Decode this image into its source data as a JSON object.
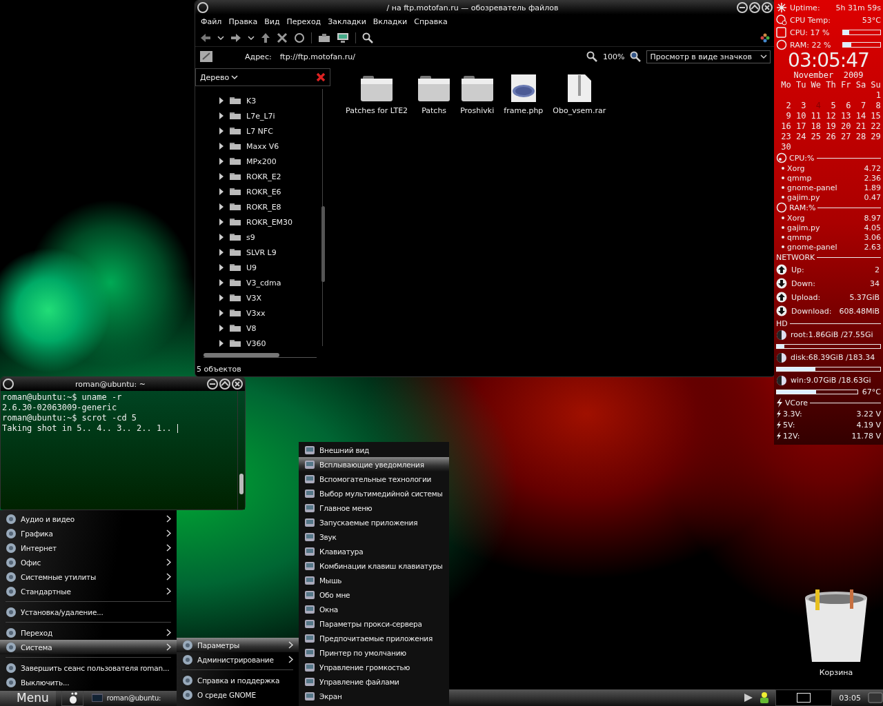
{
  "file_manager": {
    "title": "/ на ftp.motofan.ru — обозреватель файлов",
    "menu": [
      "Файл",
      "Правка",
      "Вид",
      "Переход",
      "Закладки",
      "Вкладки",
      "Справка"
    ],
    "address_label": "Адрес:",
    "address": "ftp://ftp.motofan.ru/",
    "zoom_level": "100%",
    "view_mode": "Просмотр в виде значков",
    "sidebar_label": "Дерево",
    "tree": [
      {
        "name": "K3",
        "expanded": false
      },
      {
        "name": "L7e_L7i",
        "expanded": false
      },
      {
        "name": "L7 NFC",
        "expanded": false
      },
      {
        "name": "Maxx V6",
        "expanded": false
      },
      {
        "name": "MPx200",
        "expanded": false
      },
      {
        "name": "ROKR_E2",
        "expanded": false
      },
      {
        "name": "ROKR_E6",
        "expanded": false
      },
      {
        "name": "ROKR_E8",
        "expanded": false
      },
      {
        "name": "ROKR_EM30",
        "expanded": false
      },
      {
        "name": "s9",
        "expanded": false
      },
      {
        "name": "SLVR L9",
        "expanded": false
      },
      {
        "name": "U9",
        "expanded": false
      },
      {
        "name": "V3_cdma",
        "expanded": false
      },
      {
        "name": "V3X",
        "expanded": false
      },
      {
        "name": "V3xx",
        "expanded": false
      },
      {
        "name": "V8",
        "expanded": false
      },
      {
        "name": "V360",
        "expanded": false
      }
    ],
    "files": [
      {
        "name": "Patches for LTE2",
        "kind": "folder"
      },
      {
        "name": "Patchs",
        "kind": "folder"
      },
      {
        "name": "Proshivki",
        "kind": "folder"
      },
      {
        "name": "frame.php",
        "kind": "php"
      },
      {
        "name": "Obo_vsem.rar",
        "kind": "archive"
      }
    ],
    "status": "5 объектов"
  },
  "terminal": {
    "title": "roman@ubuntu: ~",
    "lines": [
      "roman@ubuntu:~$ uname -r",
      "2.6.30-02063009-generic",
      "roman@ubuntu:~$ scrot -cd 5",
      "Taking shot in 5.. 4.. 3.. 2.. 1.."
    ]
  },
  "conky": {
    "stats": [
      {
        "label": "Uptime:",
        "value": "5h 31m 59s",
        "kind": "uptime"
      },
      {
        "label": "CPU Temp:",
        "value": "53°C",
        "kind": "temp"
      },
      {
        "label": "CPU: 17 %",
        "level": 0.17,
        "kind": "cpu"
      },
      {
        "label": "RAM: 22 %",
        "level": 0.22,
        "kind": "ram"
      }
    ],
    "clock": "03:05:47",
    "month": "November  2009",
    "weekdays": [
      "Mo",
      "Tu",
      "We",
      "Th",
      "Fr",
      "Sa",
      "Su"
    ],
    "weeks": [
      {
        "days": [
          {
            "day": "1",
            "today": false
          }
        ]
      },
      {
        "days": [
          {
            "day": "2",
            "today": false
          },
          {
            "day": "3",
            "today": false
          },
          {
            "day": "4",
            "today": true
          },
          {
            "day": "5",
            "today": false
          },
          {
            "day": "6",
            "today": false
          },
          {
            "day": "7",
            "today": false
          },
          {
            "day": "8",
            "today": false
          }
        ]
      },
      {
        "days": [
          {
            "day": "9",
            "today": false
          },
          {
            "day": "10",
            "today": false
          },
          {
            "day": "11",
            "today": false
          },
          {
            "day": "12",
            "today": false
          },
          {
            "day": "13",
            "today": false
          },
          {
            "day": "14",
            "today": false
          },
          {
            "day": "15",
            "today": false
          }
        ]
      },
      {
        "days": [
          {
            "day": "16",
            "today": false
          },
          {
            "day": "17",
            "today": false
          },
          {
            "day": "18",
            "today": false
          },
          {
            "day": "19",
            "today": false
          },
          {
            "day": "20",
            "today": false
          },
          {
            "day": "21",
            "today": false
          },
          {
            "day": "22",
            "today": false
          }
        ]
      },
      {
        "days": [
          {
            "day": "23",
            "today": false
          },
          {
            "day": "24",
            "today": false
          },
          {
            "day": "25",
            "today": false
          },
          {
            "day": "26",
            "today": false
          },
          {
            "day": "27",
            "today": false
          },
          {
            "day": "28",
            "today": false
          },
          {
            "day": "29",
            "today": false
          }
        ]
      },
      {
        "days": [
          {
            "day": "30",
            "today": false
          }
        ]
      }
    ],
    "cpu_heading": "CPU:%",
    "cpu_top": [
      {
        "name": "Xorg",
        "value": "4.72"
      },
      {
        "name": "qmmp",
        "value": "2.36"
      },
      {
        "name": "gnome-panel",
        "value": "1.89"
      },
      {
        "name": "gajim.py",
        "value": "0.47"
      }
    ],
    "ram_heading": "RAM:%",
    "ram_top": [
      {
        "name": "Xorg",
        "value": "8.97"
      },
      {
        "name": "gajim.py",
        "value": "4.05"
      },
      {
        "name": "qmmp",
        "value": "3.06"
      },
      {
        "name": "gnome-panel",
        "value": "2.63"
      }
    ],
    "network_heading": "NETWORK",
    "network": [
      {
        "label": "Up:",
        "value": "2",
        "kind": "up"
      },
      {
        "label": "Down:",
        "value": "34",
        "kind": "down"
      },
      {
        "label": "Upload:",
        "value": "5.37GiB",
        "kind": "up"
      },
      {
        "label": "Download:",
        "value": "608.48MiB",
        "kind": "down"
      }
    ],
    "hd_heading": "HD",
    "disks": [
      {
        "label": "root:1.86GiB  /27.55Gi",
        "level": 0.07
      },
      {
        "label": "disk:68.39GiB /183.34",
        "level": 0.37
      },
      {
        "label": "win:9.07GiB  /18.63Gi",
        "level": 0.49,
        "note": "67°C"
      }
    ],
    "vcore_heading": "VCore",
    "voltages": [
      {
        "label": "3.3V:",
        "value": "3.22 V"
      },
      {
        "label": "5V:",
        "value": "4.19 V"
      },
      {
        "label": "12V:",
        "value": "11.78 V"
      }
    ]
  },
  "apps_menu": [
    {
      "label": "Аудио и видео",
      "kind": "item",
      "submenu": true,
      "selected": false
    },
    {
      "label": "Графика",
      "kind": "item",
      "submenu": true,
      "selected": false
    },
    {
      "label": "Интернет",
      "kind": "item",
      "submenu": true,
      "selected": false
    },
    {
      "label": "Офис",
      "kind": "item",
      "submenu": true,
      "selected": false
    },
    {
      "label": "Системные утилиты",
      "kind": "item",
      "submenu": true,
      "selected": false
    },
    {
      "label": "Стандартные",
      "kind": "item",
      "submenu": true,
      "selected": false
    },
    {
      "kind": "separator"
    },
    {
      "label": "Установка/удаление...",
      "kind": "item",
      "submenu": false,
      "selected": false
    },
    {
      "kind": "separator"
    },
    {
      "label": "Переход",
      "kind": "item",
      "submenu": true,
      "selected": false
    },
    {
      "label": "Система",
      "kind": "item",
      "submenu": true,
      "selected": true
    },
    {
      "kind": "separator"
    },
    {
      "label": "Завершить сеанс пользователя roman...",
      "kind": "item",
      "submenu": false,
      "selected": false
    },
    {
      "label": "Выключить...",
      "kind": "item",
      "submenu": false,
      "selected": false
    }
  ],
  "system_menu": [
    {
      "label": "Параметры",
      "kind": "item",
      "submenu": true,
      "selected": true
    },
    {
      "label": "Администрирование",
      "kind": "item",
      "submenu": true,
      "selected": false
    },
    {
      "kind": "separator"
    },
    {
      "label": "Справка и поддержка",
      "kind": "item",
      "submenu": false,
      "selected": false
    },
    {
      "label": "О среде GNOME",
      "kind": "item",
      "submenu": false,
      "selected": false
    }
  ],
  "preferences_menu": [
    {
      "label": "Внешний вид",
      "selected": false
    },
    {
      "label": "Всплывающие уведомления",
      "selected": true
    },
    {
      "label": "Вспомогательные технологии",
      "selected": false
    },
    {
      "label": "Выбор мультимедийной системы",
      "selected": false
    },
    {
      "label": "Главное меню",
      "selected": false
    },
    {
      "label": "Запускаемые приложения",
      "selected": false
    },
    {
      "label": "Звук",
      "selected": false
    },
    {
      "label": "Клавиатура",
      "selected": false
    },
    {
      "label": "Комбинации клавиш клавиатуры",
      "selected": false
    },
    {
      "label": "Мышь",
      "selected": false
    },
    {
      "label": "Обо мне",
      "selected": false
    },
    {
      "label": "Окна",
      "selected": false
    },
    {
      "label": "Параметры прокси-сервера",
      "selected": false
    },
    {
      "label": "Предпочитаемые приложения",
      "selected": false
    },
    {
      "label": "Принтер по умолчанию",
      "selected": false
    },
    {
      "label": "Управление громкостью",
      "selected": false
    },
    {
      "label": "Управление файлами",
      "selected": false
    },
    {
      "label": "Экран",
      "selected": false
    }
  ],
  "desktop_icons": [
    {
      "label": "Корзина"
    }
  ],
  "taskbar": {
    "menu_button": "Menu",
    "task": "roman@ubuntu:",
    "clock": "03:05"
  }
}
